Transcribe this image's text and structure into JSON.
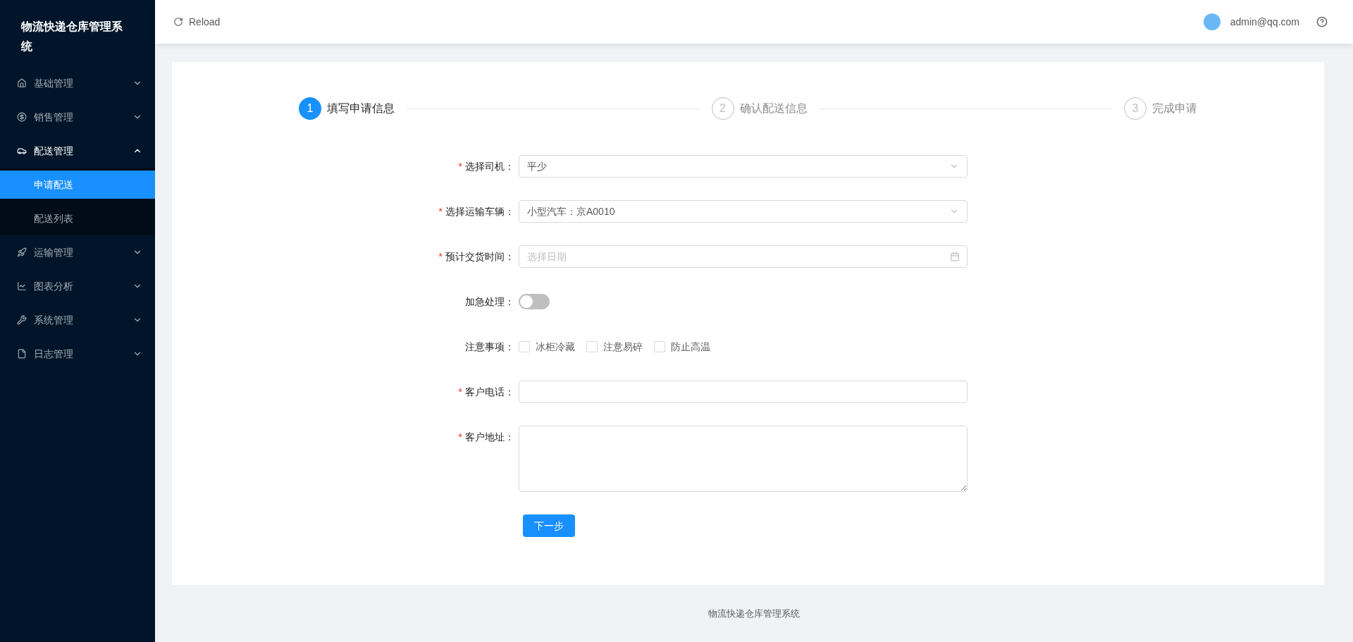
{
  "sidebar": {
    "title": "物流快递仓库管理系统",
    "items": [
      {
        "label": "基础管理",
        "expanded": false
      },
      {
        "label": "销售管理",
        "expanded": false
      },
      {
        "label": "配送管理",
        "expanded": true,
        "children": [
          {
            "label": "申请配送",
            "selected": true
          },
          {
            "label": "配送列表",
            "selected": false
          }
        ]
      },
      {
        "label": "运输管理",
        "expanded": false
      },
      {
        "label": "图表分析",
        "expanded": false
      },
      {
        "label": "系统管理",
        "expanded": false
      },
      {
        "label": "日志管理",
        "expanded": false
      }
    ]
  },
  "header": {
    "reload": "Reload",
    "user": "admin@qq.com"
  },
  "steps": [
    {
      "number": "1",
      "label": "填写申请信息",
      "active": true
    },
    {
      "number": "2",
      "label": "确认配送信息",
      "active": false
    },
    {
      "number": "3",
      "label": "完成申请",
      "active": false
    }
  ],
  "form": {
    "fields": [
      {
        "kind": "select",
        "label": "选择司机：",
        "required_mark": "*",
        "value": "平少"
      },
      {
        "kind": "select",
        "label": "选择运输车辆：",
        "required_mark": "*",
        "value": "小型汽车：京A0010"
      },
      {
        "kind": "date",
        "label": "预计交货时间：",
        "required_mark": "*",
        "placeholder": "选择日期"
      },
      {
        "kind": "switch",
        "label": "加急处理：",
        "on": false
      },
      {
        "kind": "checkboxes",
        "label": "注意事项：",
        "options": [
          {
            "label": "冰柜冷藏",
            "checked": false
          },
          {
            "label": "注意易碎",
            "checked": false
          },
          {
            "label": "防止高温",
            "checked": false
          }
        ]
      },
      {
        "kind": "input",
        "label": "客户电话：",
        "required_mark": "*"
      },
      {
        "kind": "textarea",
        "label": "客户地址：",
        "required_mark": "*"
      }
    ],
    "submit": "下一步"
  },
  "footer": "物流快递仓库管理系统"
}
